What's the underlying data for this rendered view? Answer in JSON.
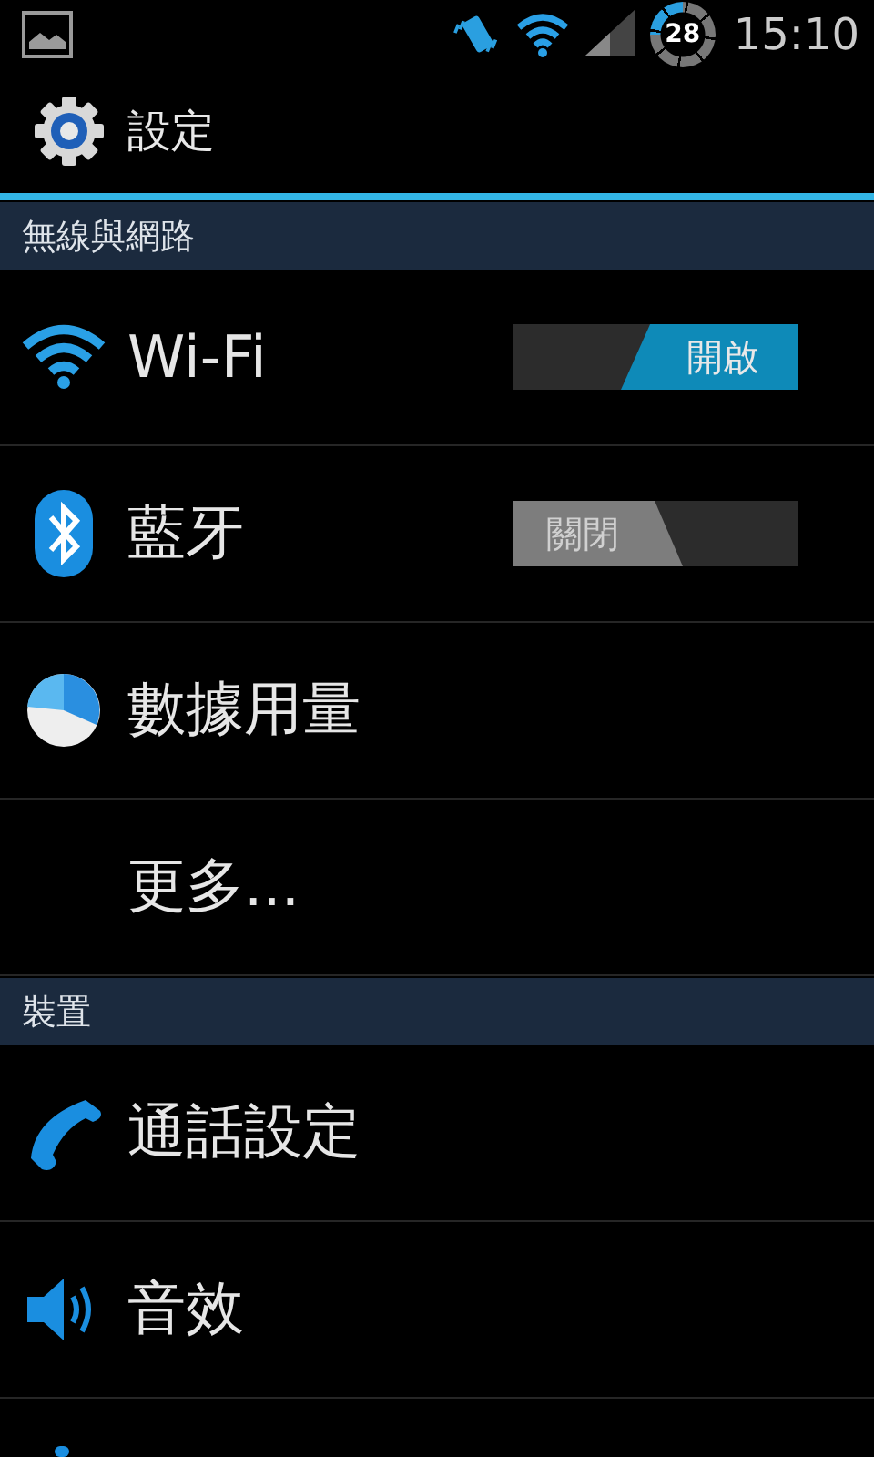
{
  "status_bar": {
    "battery": "28",
    "time": "15:10"
  },
  "action_bar": {
    "title": "設定"
  },
  "sections": [
    {
      "header": "無線與網路",
      "items": [
        {
          "label": "Wi-Fi",
          "kind": "toggle",
          "switch": {
            "on": true,
            "text": "開啟"
          }
        },
        {
          "label": "藍牙",
          "kind": "toggle",
          "switch": {
            "on": false,
            "text": "關閉"
          }
        },
        {
          "label": "數據用量",
          "kind": "plain"
        },
        {
          "label": "更多...",
          "kind": "plain"
        }
      ]
    },
    {
      "header": "裝置",
      "items": [
        {
          "label": "通話設定",
          "kind": "plain"
        },
        {
          "label": "音效",
          "kind": "plain"
        }
      ]
    }
  ]
}
